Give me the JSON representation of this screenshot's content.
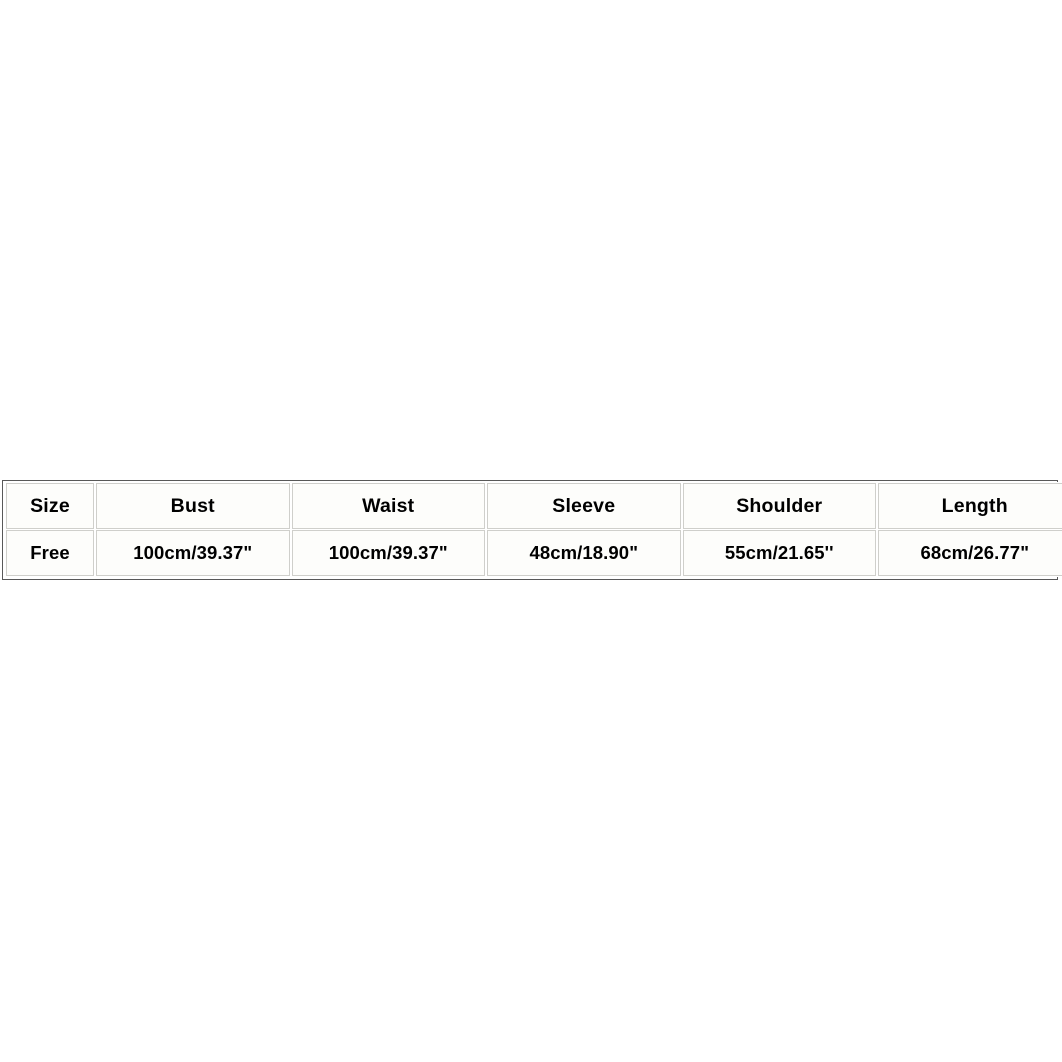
{
  "size_chart": {
    "columns": [
      "Size",
      "Bust",
      "Waist",
      "Sleeve",
      "Shoulder",
      "Length"
    ],
    "rows": [
      {
        "size": "Free",
        "bust": "100cm/39.37\"",
        "waist": "100cm/39.37\"",
        "sleeve": "48cm/18.90\"",
        "shoulder": "55cm/21.65''",
        "length": "68cm/26.77\""
      }
    ],
    "colors": {
      "text": "#000000",
      "cell_border": "#cfcfcb",
      "outer_border": "#585858",
      "background": "#ffffff",
      "cell_background": "#fdfdfb"
    }
  },
  "chart_data": {
    "type": "table",
    "title": "",
    "columns": [
      "Size",
      "Bust",
      "Waist",
      "Sleeve",
      "Shoulder",
      "Length"
    ],
    "rows": [
      [
        "Free",
        "100cm/39.37\"",
        "100cm/39.37\"",
        "48cm/18.90\"",
        "55cm/21.65''",
        "68cm/26.77\""
      ]
    ],
    "units": "cm / inches",
    "measurements_cm": {
      "bust": 100,
      "waist": 100,
      "sleeve": 48,
      "shoulder": 55,
      "length": 68
    },
    "measurements_in": {
      "bust": 39.37,
      "waist": 39.37,
      "sleeve": 18.9,
      "shoulder": 21.65,
      "length": 26.77
    }
  }
}
